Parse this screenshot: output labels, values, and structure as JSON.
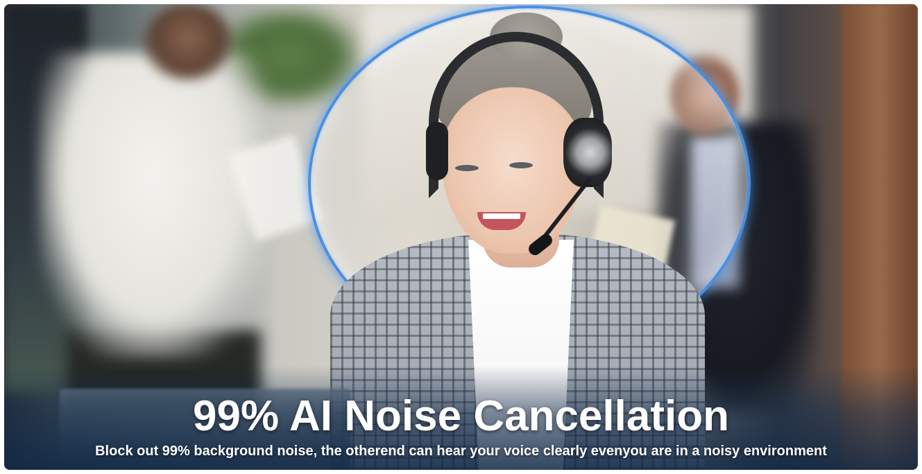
{
  "banner": {
    "headline": "99% AI Noise Cancellation",
    "subline": "Block out 99% background noise, the otherend can hear your voice clearly evenyou are in a noisy environment"
  },
  "colors": {
    "bubble_accent": "#4a8fe0",
    "text": "#ffffff"
  }
}
